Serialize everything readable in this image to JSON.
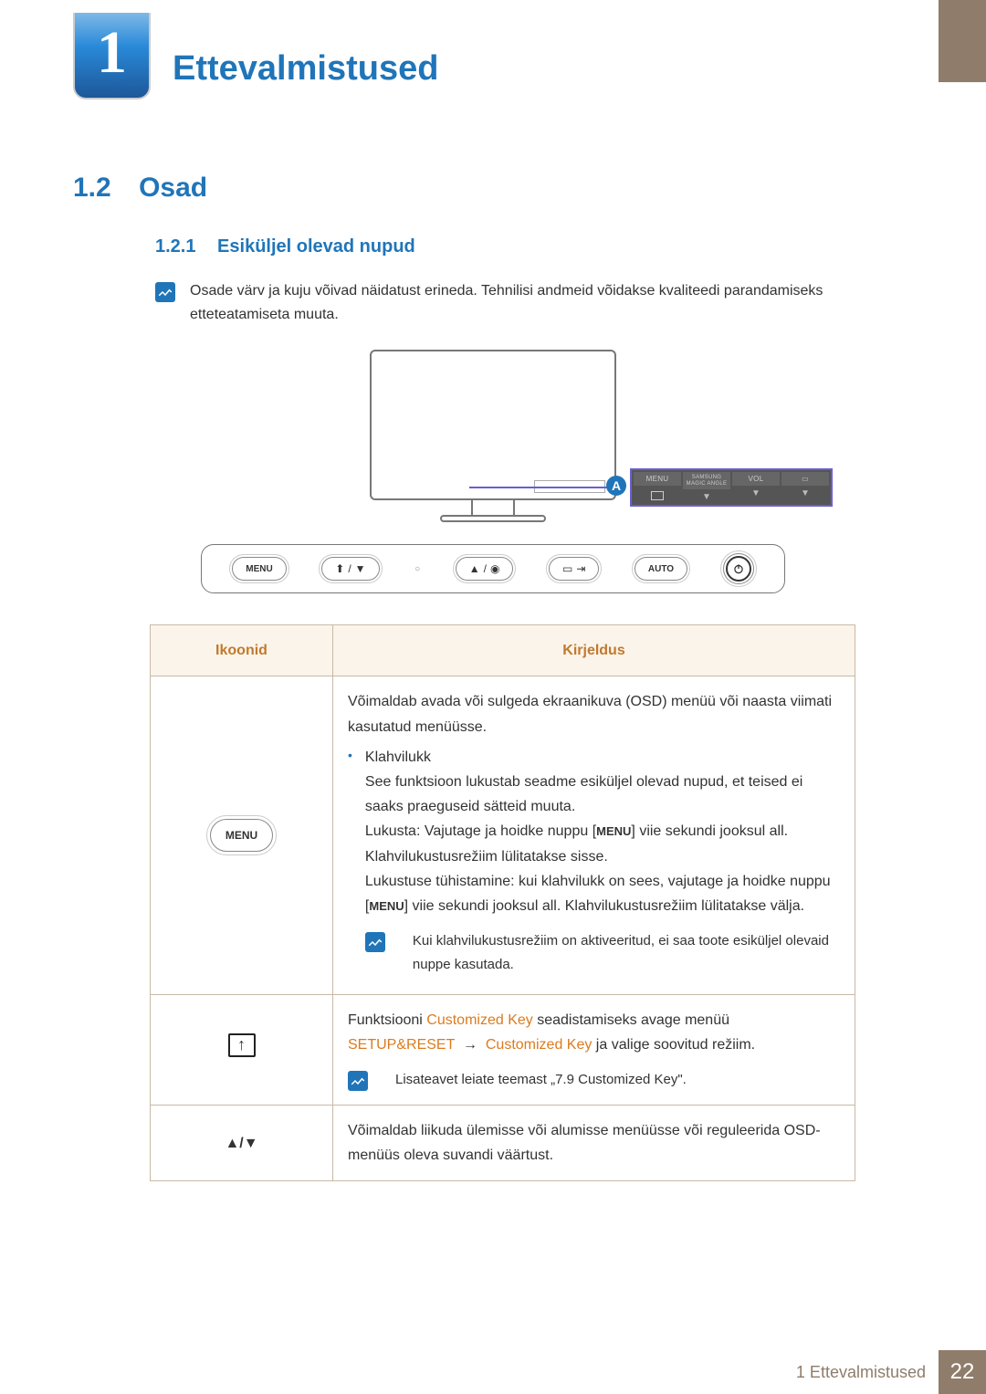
{
  "chapter": {
    "number": "1",
    "title": "Ettevalmistused"
  },
  "section": {
    "number": "1.2",
    "title": "Osad"
  },
  "subsection": {
    "number": "1.2.1",
    "title": "Esiküljel olevad nupud"
  },
  "intro_note": "Osade värv ja kuju võivad näidatust erineda. Tehnilisi andmeid võidakse kvaliteedi parandamiseks etteteatamiseta muuta.",
  "diagram": {
    "callout_letter": "A",
    "zoom_labels": {
      "menu": "MENU",
      "brand": "SAMSUNG",
      "magic": "MAGIC ANGLE",
      "vol": "VOL"
    },
    "button_row": {
      "menu": "MENU",
      "auto": "AUTO"
    }
  },
  "table": {
    "headers": {
      "icons": "Ikoonid",
      "description": "Kirjeldus"
    },
    "row1": {
      "icon_label": "MENU",
      "p1": "Võimaldab avada või sulgeda ekraanikuva (OSD) menüü või naasta viimati kasutatud menüüsse.",
      "bullet_label": "Klahvilukk",
      "p2": "See funktsioon lukustab seadme esiküljel olevad nupud, et teised ei saaks praeguseid sätteid muuta.",
      "p3a": "Lukusta: Vajutage ja hoidke nuppu [",
      "p3b": "] viie sekundi jooksul all. Klahvilukustusrežiim lülitatakse sisse.",
      "p4a": "Lukustuse tühistamine: kui klahvilukk on sees, vajutage ja hoidke nuppu [",
      "p4b": "] viie sekundi jooksul all. Klahvilukustusrežiim lülitatakse välja.",
      "inline_menu": "MENU",
      "note": "Kui klahvilukustusrežiim on aktiveeritud, ei saa toote esiküljel olevaid nuppe kasutada."
    },
    "row2": {
      "p1a": "Funktsiooni ",
      "p1b": "Customized Key",
      "p1c": " seadistamiseks avage menüü",
      "p2a": "SETUP&RESET",
      "arrow": "→",
      "p2b": "Customized Key",
      "p2c": " ja valige soovitud režiim.",
      "note": "Lisateavet leiate teemast „7.9 Customized Key\"."
    },
    "row3": {
      "icon": "▲/▼",
      "desc": "Võimaldab liikuda ülemisse või alumisse menüüsse või reguleerida OSD-menüüs oleva suvandi väärtust."
    }
  },
  "footer": {
    "text": "1 Ettevalmistused",
    "page": "22"
  }
}
